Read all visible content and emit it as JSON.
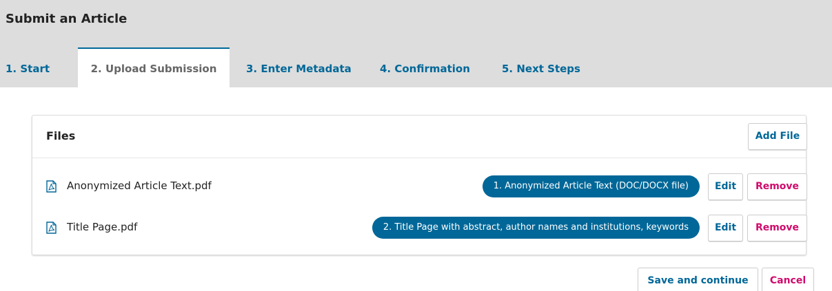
{
  "header": {
    "title": "Submit an Article"
  },
  "tabs": [
    {
      "label": "1. Start"
    },
    {
      "label": "2. Upload Submission"
    },
    {
      "label": "3. Enter Metadata"
    },
    {
      "label": "4. Confirmation"
    },
    {
      "label": "5. Next Steps"
    }
  ],
  "active_tab": "2. Upload Submission",
  "files_panel": {
    "title": "Files",
    "add_file_label": "Add File",
    "files": [
      {
        "name": "Anonymized Article Text.pdf",
        "icon": "pdf-file-icon",
        "component": "1. Anonymized Article Text (DOC/DOCX file)",
        "edit_label": "Edit",
        "remove_label": "Remove"
      },
      {
        "name": "Title Page.pdf",
        "icon": "pdf-file-icon",
        "component": "2. Title Page with abstract, author names and institutions, keywords",
        "edit_label": "Edit",
        "remove_label": "Remove"
      }
    ]
  },
  "footer": {
    "save_label": "Save and continue",
    "cancel_label": "Cancel"
  },
  "colors": {
    "primary": "#006798",
    "danger": "#d00a6c",
    "header_bg": "#dddddd",
    "muted_text": "#666666"
  }
}
